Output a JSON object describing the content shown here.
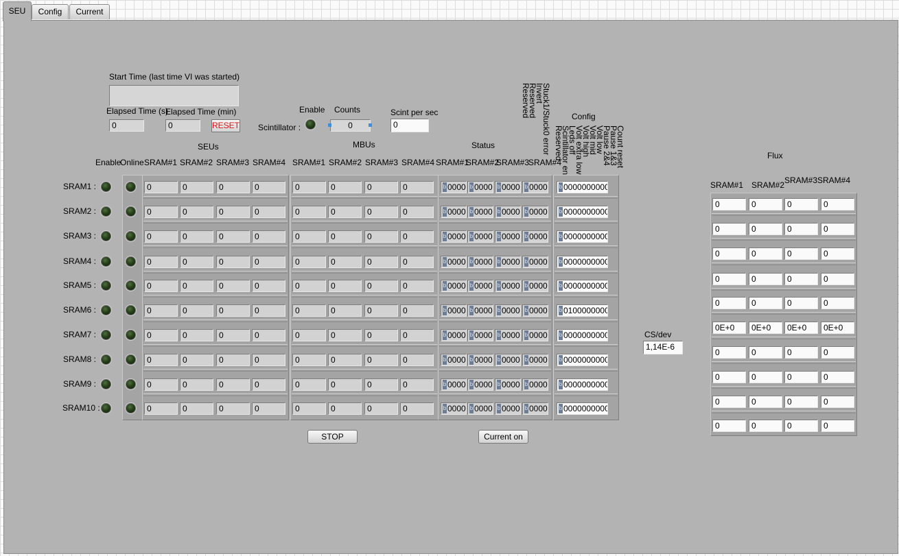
{
  "tabs": [
    "SEU",
    "Config",
    "Current"
  ],
  "start_time": {
    "label": "Start Time (last time VI was started)",
    "value": ""
  },
  "elapsed_s": {
    "label": "Elapsed Time (s)",
    "value": "0"
  },
  "elapsed_min": {
    "label": "Elapsed Time (min)",
    "value": "0"
  },
  "reset_label": "RESET",
  "scintillator": {
    "label": "Scintillator :",
    "enable_label": "Enable",
    "counts_label": "Counts",
    "counts_value": "0",
    "scint_per_sec_label": "Scint per sec",
    "scint_per_sec_value": "0"
  },
  "sections": {
    "seus": "SEUs",
    "mbus": "MBUs",
    "status": "Status",
    "config": "Config",
    "flux": "Flux"
  },
  "col_headers": {
    "enable": "Enable",
    "online": "Online"
  },
  "sram_cols": [
    "SRAM#1",
    "SRAM#2",
    "SRAM#3",
    "SRAM#4"
  ],
  "status_bits": [
    "Stuck1/Stuck0 error",
    "Invert",
    "Reserved",
    "Reserved"
  ],
  "config_bits": [
    "Count reset",
    "Pause 1&3",
    "Pause 2&4",
    "Volt low",
    "Volt mid",
    "Volt high",
    "Volt extra low",
    "Leds off",
    "Scintillator en",
    "Reserved"
  ],
  "rows": [
    "SRAM1 :",
    "SRAM2 :",
    "SRAM3 :",
    "SRAM4 :",
    "SRAM5 :",
    "SRAM6 :",
    "SRAM7 :",
    "SRAM8 :",
    "SRAM9 :",
    "SRAM10 :"
  ],
  "seus": [
    [
      "0",
      "0",
      "0",
      "0"
    ],
    [
      "0",
      "0",
      "0",
      "0"
    ],
    [
      "0",
      "0",
      "0",
      "0"
    ],
    [
      "0",
      "0",
      "0",
      "0"
    ],
    [
      "0",
      "0",
      "0",
      "0"
    ],
    [
      "0",
      "0",
      "0",
      "0"
    ],
    [
      "0",
      "0",
      "0",
      "0"
    ],
    [
      "0",
      "0",
      "0",
      "0"
    ],
    [
      "0",
      "0",
      "0",
      "0"
    ],
    [
      "0",
      "0",
      "0",
      "0"
    ]
  ],
  "mbus": [
    [
      "0",
      "0",
      "0",
      "0"
    ],
    [
      "0",
      "0",
      "0",
      "0"
    ],
    [
      "0",
      "0",
      "0",
      "0"
    ],
    [
      "0",
      "0",
      "0",
      "0"
    ],
    [
      "0",
      "0",
      "0",
      "0"
    ],
    [
      "0",
      "0",
      "0",
      "0"
    ],
    [
      "0",
      "0",
      "0",
      "0"
    ],
    [
      "0",
      "0",
      "0",
      "0"
    ],
    [
      "0",
      "0",
      "0",
      "0"
    ],
    [
      "0",
      "0",
      "0",
      "0"
    ]
  ],
  "status": [
    [
      "0000",
      "0000",
      "0000",
      "0000"
    ],
    [
      "0000",
      "0000",
      "0000",
      "0000"
    ],
    [
      "0000",
      "0000",
      "0000",
      "0000"
    ],
    [
      "0000",
      "0000",
      "0000",
      "0000"
    ],
    [
      "0000",
      "0000",
      "0000",
      "0000"
    ],
    [
      "0000",
      "0000",
      "0000",
      "0000"
    ],
    [
      "0000",
      "0000",
      "0000",
      "0000"
    ],
    [
      "0000",
      "0000",
      "0000",
      "0000"
    ],
    [
      "0000",
      "0000",
      "0000",
      "0000"
    ],
    [
      "0000",
      "0000",
      "0000",
      "0000"
    ]
  ],
  "config": [
    "0000000000",
    "0000000000",
    "0000000000",
    "0000000000",
    "0000000000",
    "0100000000",
    "0000000000",
    "0000000000",
    "0000000000",
    "0000000000"
  ],
  "flux_cols": [
    "SRAM#1",
    "SRAM#2",
    "SRAM#3",
    "SRAM#4"
  ],
  "flux": [
    [
      "0",
      "0",
      "0",
      "0"
    ],
    [
      "0",
      "0",
      "0",
      "0"
    ],
    [
      "0",
      "0",
      "0",
      "0"
    ],
    [
      "0",
      "0",
      "0",
      "0"
    ],
    [
      "0",
      "0",
      "0",
      "0"
    ],
    [
      "0E+0",
      "0E+0",
      "0E+0",
      "0E+0"
    ],
    [
      "0",
      "0",
      "0",
      "0"
    ],
    [
      "0",
      "0",
      "0",
      "0"
    ],
    [
      "0",
      "0",
      "0",
      "0"
    ],
    [
      "0",
      "0",
      "0",
      "0"
    ]
  ],
  "cs_dev": {
    "label": "CS/dev",
    "value": "1,14E-6"
  },
  "stop_label": "STOP",
  "current_on_label": "Current on"
}
